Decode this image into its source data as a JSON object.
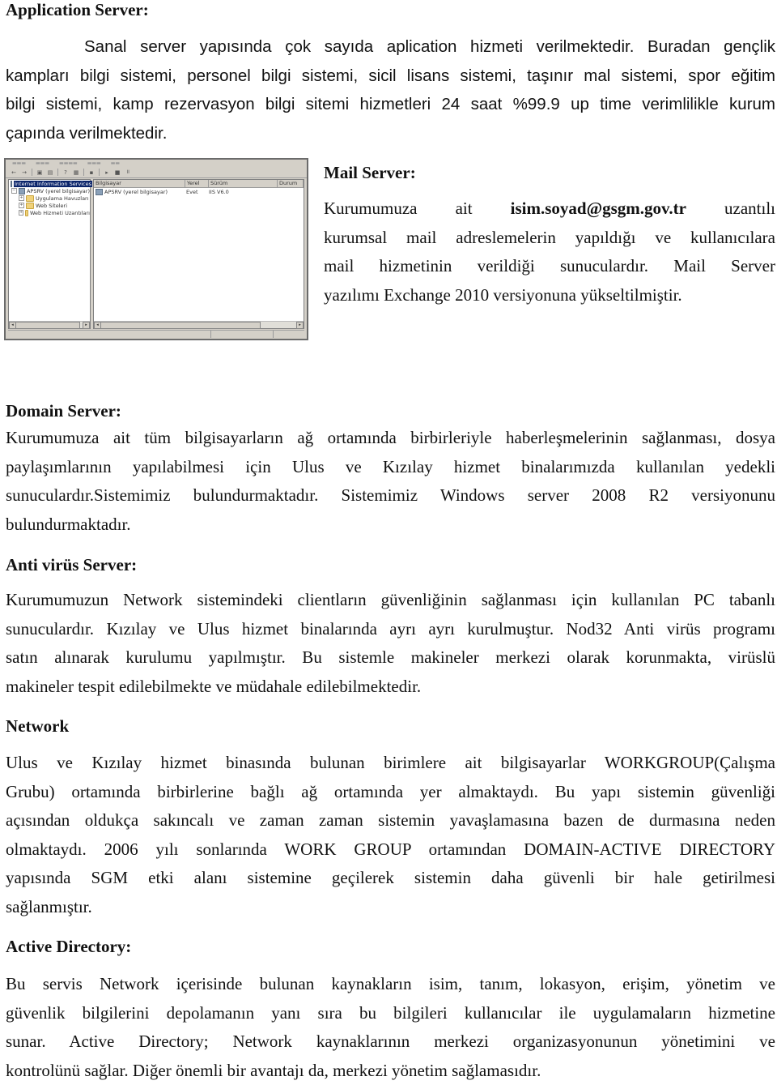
{
  "sections": {
    "application": {
      "heading": "Application Server:",
      "lines": [
        "Sanal server yapısında çok sayıda aplication hizmeti verilmektedir. Buradan gençlik",
        "kampları bilgi sistemi, personel bilgi sistemi, sicil lisans sistemi, taşınır mal sistemi, spor eğitim",
        "bilgi sistemi, kamp rezervasyon bilgi sitemi hizmetleri 24 saat %99.9 up time verimlilikle kurum",
        "çapında verilmektedir."
      ]
    },
    "mail": {
      "heading": "Mail Server:",
      "line1_prefix": "Kurumumuza",
      "line1_word": "ait",
      "line1_email": "isim.soyad@gsgm.gov.tr",
      "line1_suffix": "uzantılı",
      "lines": [
        "kurumsal mail adreslemelerin yapıldığı ve kullanıcılara",
        "mail hizmetinin verildiği sunuculardır. Mail Server",
        "yazılımı Exchange 2010 versiyonuna yükseltilmiştir."
      ]
    },
    "domain": {
      "heading": "Domain Server:",
      "lines": [
        "Kurumumuza ait tüm bilgisayarların ağ ortamında birbirleriyle haberleşmelerinin sağlanması, dosya",
        "paylaşımlarının yapılabilmesi için Ulus ve Kızılay hizmet binalarımızda kullanılan yedekli",
        "sunuculardır.Sistemimiz bulundurmaktadır. Sistemimiz Windows server 2008 R2 versiyonunu",
        "bulundurmaktadır."
      ]
    },
    "antivirus": {
      "heading": "Anti virüs Server:",
      "lines": [
        "Kurumumuzun Network sistemindeki clientların güvenliğinin sağlanması için kullanılan PC tabanlı",
        "sunuculardır. Kızılay ve Ulus hizmet binalarında ayrı ayrı kurulmuştur. Nod32 Anti virüs programı",
        "satın alınarak kurulumu yapılmıştır. Bu sistemle makineler merkezi olarak korunmakta, virüslü",
        "makineler tespit edilebilmekte ve müdahale edilebilmektedir."
      ]
    },
    "network": {
      "heading": "Network",
      "lines": [
        "Ulus ve Kızılay hizmet binasında bulunan birimlere ait bilgisayarlar WORKGROUP(Çalışma",
        "Grubu) ortamında birbirlerine bağlı ağ ortamında yer almaktaydı. Bu yapı sistemin güvenliği",
        "açısından oldukça sakıncalı ve zaman zaman sistemin yavaşlamasına bazen de durmasına neden",
        "olmaktaydı. 2006 yılı sonlarında WORK GROUP ortamından DOMAIN-ACTIVE DIRECTORY",
        "yapısında SGM etki alanı sistemine geçilerek sistemin daha güvenli bir hale getirilmesi",
        "sağlanmıştır."
      ]
    },
    "active_directory": {
      "heading": "Active Directory:",
      "lines": [
        "Bu servis Network içerisinde bulunan kaynakların isim, tanım, lokasyon, erişim, yönetim ve",
        "güvenlik bilgilerini depolamanın yanı sıra bu bilgileri kullanıcılar ile uygulamaların hizmetine",
        "sunar. Active Directory; Network kaynaklarının merkezi organizasyonunun yönetimini ve",
        "kontrolünü sağlar. Diğer önemli bir avantajı da, merkezi yönetim sağlamasıdır."
      ]
    }
  },
  "iis_screenshot": {
    "tree": {
      "root": "Internet Information Services",
      "server": "APSRV (yerel bilgisayar)",
      "children": [
        "Uygulama Havuzları",
        "Web Siteleri",
        "Web Hizmeti Uzantıları"
      ]
    },
    "columns": [
      "Bilgisayar",
      "Yerel",
      "Sürüm",
      "Durum"
    ],
    "rows": [
      {
        "name": "APSRV (yerel bilgisayar)",
        "local": "Evet",
        "version": "IIS V6.0",
        "status": ""
      }
    ]
  }
}
